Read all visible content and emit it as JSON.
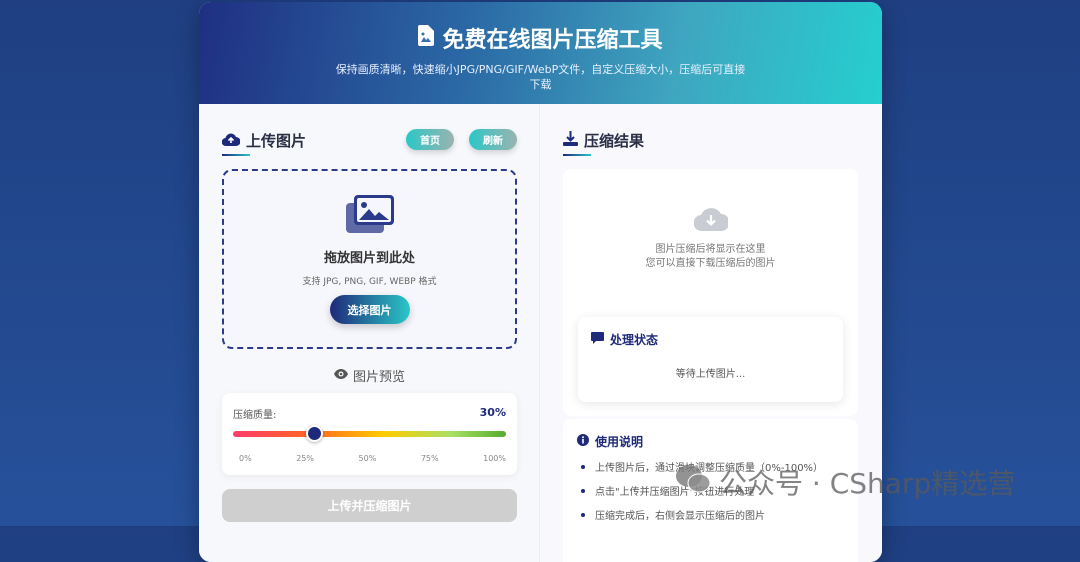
{
  "header": {
    "title": "免费在线图片压缩工具",
    "subtitle": "保持画质清晰，快速缩小JPG/PNG/GIF/WebP文件，自定义压缩大小，压缩后可直接下载"
  },
  "upload": {
    "title": "上传图片",
    "home_label": "首页",
    "refresh_label": "刷新",
    "drop_title": "拖放图片到此处",
    "drop_hint": "支持 JPG, PNG, GIF, WEBP 格式",
    "select_label": "选择图片",
    "preview_label": "图片预览",
    "quality_label": "压缩质量:",
    "quality_value": "30%",
    "quality_fraction": 0.3,
    "ticks": [
      "0%",
      "25%",
      "50%",
      "75%",
      "100%"
    ],
    "submit_label": "上传并压缩图片"
  },
  "result": {
    "title": "压缩结果",
    "placeholder_line1": "图片压缩后将显示在这里",
    "placeholder_line2": "您可以直接下载压缩后的图片",
    "status_title": "处理状态",
    "status_text": "等待上传图片...",
    "usage_title": "使用说明",
    "usage": [
      "上传图片后，通过滑块调整压缩质量（0%-100%）",
      "点击\"上传并压缩图片\"按钮进行处理",
      "压缩完成后，右侧会显示压缩后的图片"
    ]
  },
  "watermark": "公众号 · CSharp精选营",
  "colors": {
    "primary": "#1e2a7a",
    "accent": "#2ac7c7"
  }
}
